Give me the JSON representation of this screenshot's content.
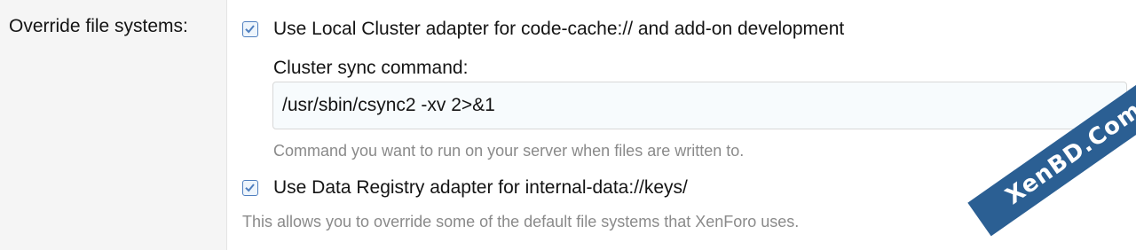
{
  "row": {
    "label": "Override file systems:"
  },
  "options": [
    {
      "label": "Use Local Cluster adapter for code-cache:// and add-on development",
      "checked": true
    },
    {
      "label": "Use Data Registry adapter for internal-data://keys/",
      "checked": true
    }
  ],
  "cluster_sync": {
    "label": "Cluster sync command:",
    "value": "/usr/sbin/csync2 -xv 2>&1",
    "hint": "Command you want to run on your server when files are written to."
  },
  "row_hint": "This allows you to override some of the default file systems that XenForo uses.",
  "watermark": "XenBD.Com",
  "colors": {
    "accent": "#4f7fbf",
    "label_bg": "#f5f5f5",
    "hint": "#8a8a8a",
    "watermark_bg": "#2b5f93"
  }
}
